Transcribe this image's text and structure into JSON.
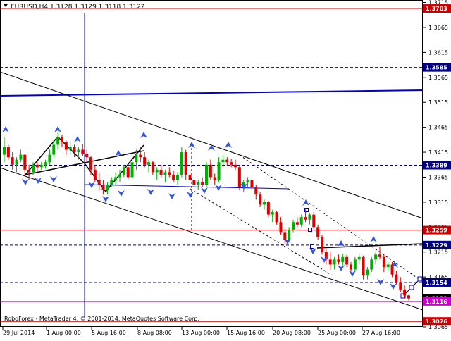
{
  "window": {
    "symbol_header": "EURUSD,H4  1.3128 1.3129 1.3118 1.3122",
    "copyright": "RoboForex - MetaTrader 4, © 2001-2014, MetaQuotes Software Corp."
  },
  "chart_data": {
    "type": "candlestick",
    "symbol": "EURUSD",
    "timeframe": "H4",
    "ohlc_last": {
      "open": 1.3128,
      "high": 1.3129,
      "low": 1.3118,
      "close": 1.3122
    },
    "ylim": [
      1.3065,
      1.372
    ],
    "y_ticks": [
      "1.3715",
      "1.3665",
      "1.3615",
      "1.3565",
      "1.3515",
      "1.3465",
      "1.3415",
      "1.3365",
      "1.3315",
      "1.3265",
      "1.3215",
      "1.3165",
      "1.3115",
      "1.3065"
    ],
    "x_tick_labels": [
      "29 Jul 2014",
      "1 Aug 00:00",
      "5 Aug 16:00",
      "8 Aug 08:00",
      "13 Aug 00:00",
      "15 Aug 16:00",
      "20 Aug 08:00",
      "25 Aug 00:00",
      "27 Aug 16:00"
    ],
    "price_levels": [
      {
        "label": "1.3703",
        "value": 1.3703,
        "style": "solid",
        "color": "#cc0000"
      },
      {
        "label": "1.3585",
        "value": 1.3585,
        "style": "dashed",
        "color": "#000080"
      },
      {
        "label": "1.3389",
        "value": 1.3389,
        "style": "dashed",
        "color": "#000080"
      },
      {
        "label": "1.3259",
        "value": 1.3259,
        "style": "solid",
        "color": "#cc0000"
      },
      {
        "label": "1.3229",
        "value": 1.3229,
        "style": "dashed",
        "color": "#000080"
      },
      {
        "label": "1.3154",
        "value": 1.3154,
        "style": "dashed",
        "color": "#000080"
      },
      {
        "label": "1.3122",
        "value": 1.3122,
        "style": "solid",
        "color": "#000000"
      },
      {
        "label": "1.3116",
        "value": 1.3116,
        "style": "solid",
        "color": "#cc00cc"
      },
      {
        "label": "1.3076",
        "value": 1.3076,
        "style": "solid",
        "color": "#cc0000"
      }
    ],
    "candles": [
      [
        1.341,
        1.3445,
        1.3395,
        1.3425
      ],
      [
        1.3425,
        1.343,
        1.34,
        1.3405
      ],
      [
        1.3405,
        1.3415,
        1.338,
        1.339
      ],
      [
        1.339,
        1.3405,
        1.3375,
        1.34
      ],
      [
        1.34,
        1.342,
        1.3395,
        1.341
      ],
      [
        1.341,
        1.3412,
        1.337,
        1.338
      ],
      [
        1.338,
        1.339,
        1.336,
        1.3375
      ],
      [
        1.3375,
        1.3395,
        1.337,
        1.339
      ],
      [
        1.339,
        1.3398,
        1.3375,
        1.3385
      ],
      [
        1.3385,
        1.3395,
        1.338,
        1.339
      ],
      [
        1.339,
        1.34,
        1.3382,
        1.3395
      ],
      [
        1.3395,
        1.342,
        1.339,
        1.341
      ],
      [
        1.341,
        1.344,
        1.3405,
        1.343
      ],
      [
        1.343,
        1.3455,
        1.342,
        1.3445
      ],
      [
        1.3445,
        1.345,
        1.3425,
        1.3435
      ],
      [
        1.3435,
        1.344,
        1.341,
        1.342
      ],
      [
        1.342,
        1.3435,
        1.3412,
        1.3425
      ],
      [
        1.3425,
        1.343,
        1.3405,
        1.3415
      ],
      [
        1.3415,
        1.3425,
        1.34,
        1.342
      ],
      [
        1.342,
        1.3432,
        1.3408,
        1.3412
      ],
      [
        1.3412,
        1.342,
        1.3395,
        1.3405
      ],
      [
        1.3405,
        1.3408,
        1.337,
        1.338
      ],
      [
        1.338,
        1.339,
        1.3355,
        1.336
      ],
      [
        1.336,
        1.3375,
        1.334,
        1.335
      ],
      [
        1.335,
        1.336,
        1.333,
        1.334
      ],
      [
        1.334,
        1.3355,
        1.333,
        1.335
      ],
      [
        1.335,
        1.3365,
        1.3345,
        1.336
      ],
      [
        1.336,
        1.3375,
        1.335,
        1.3365
      ],
      [
        1.3365,
        1.338,
        1.3355,
        1.337
      ],
      [
        1.337,
        1.339,
        1.3365,
        1.3385
      ],
      [
        1.3385,
        1.3395,
        1.336,
        1.3365
      ],
      [
        1.3365,
        1.34,
        1.336,
        1.3395
      ],
      [
        1.3395,
        1.342,
        1.338,
        1.341
      ],
      [
        1.341,
        1.3425,
        1.3395,
        1.3405
      ],
      [
        1.3405,
        1.3415,
        1.3385,
        1.339
      ],
      [
        1.339,
        1.34,
        1.3375,
        1.3395
      ],
      [
        1.3395,
        1.3398,
        1.337,
        1.3375
      ],
      [
        1.3375,
        1.3385,
        1.336,
        1.338
      ],
      [
        1.338,
        1.339,
        1.3365,
        1.337
      ],
      [
        1.337,
        1.338,
        1.3355,
        1.3375
      ],
      [
        1.3375,
        1.3385,
        1.3365,
        1.337
      ],
      [
        1.337,
        1.3378,
        1.3355,
        1.336
      ],
      [
        1.336,
        1.3375,
        1.335,
        1.337
      ],
      [
        1.337,
        1.3425,
        1.3365,
        1.3415
      ],
      [
        1.3415,
        1.342,
        1.336,
        1.337
      ],
      [
        1.337,
        1.338,
        1.3355,
        1.336
      ],
      [
        1.336,
        1.3368,
        1.3345,
        1.335
      ],
      [
        1.335,
        1.336,
        1.334,
        1.3355
      ],
      [
        1.3355,
        1.3365,
        1.3345,
        1.335
      ],
      [
        1.335,
        1.3395,
        1.3345,
        1.339
      ],
      [
        1.339,
        1.34,
        1.336,
        1.3365
      ],
      [
        1.3365,
        1.3372,
        1.335,
        1.336
      ],
      [
        1.336,
        1.3405,
        1.3355,
        1.3395
      ],
      [
        1.3395,
        1.341,
        1.3385,
        1.34
      ],
      [
        1.34,
        1.3405,
        1.3388,
        1.3395
      ],
      [
        1.3395,
        1.3402,
        1.3385,
        1.339
      ],
      [
        1.339,
        1.34,
        1.338,
        1.3385
      ],
      [
        1.3385,
        1.339,
        1.334,
        1.3345
      ],
      [
        1.3345,
        1.336,
        1.3335,
        1.3355
      ],
      [
        1.3355,
        1.3365,
        1.3345,
        1.336
      ],
      [
        1.336,
        1.3363,
        1.334,
        1.3345
      ],
      [
        1.3345,
        1.335,
        1.332,
        1.333
      ],
      [
        1.333,
        1.3335,
        1.3305,
        1.331
      ],
      [
        1.331,
        1.332,
        1.33,
        1.3315
      ],
      [
        1.3315,
        1.3318,
        1.3285,
        1.329
      ],
      [
        1.329,
        1.33,
        1.3275,
        1.3295
      ],
      [
        1.3295,
        1.3298,
        1.327,
        1.3275
      ],
      [
        1.3275,
        1.3285,
        1.325,
        1.3255
      ],
      [
        1.3255,
        1.3262,
        1.3232,
        1.324
      ],
      [
        1.324,
        1.3265,
        1.3235,
        1.326
      ],
      [
        1.326,
        1.328,
        1.3255,
        1.3275
      ],
      [
        1.3275,
        1.3285,
        1.3265,
        1.327
      ],
      [
        1.327,
        1.329,
        1.3265,
        1.3285
      ],
      [
        1.3285,
        1.33,
        1.3275,
        1.328
      ],
      [
        1.328,
        1.3292,
        1.327,
        1.329
      ],
      [
        1.329,
        1.3298,
        1.326,
        1.3265
      ],
      [
        1.3265,
        1.327,
        1.324,
        1.3245
      ],
      [
        1.3245,
        1.325,
        1.321,
        1.3215
      ],
      [
        1.3215,
        1.322,
        1.319,
        1.32
      ],
      [
        1.32,
        1.3215,
        1.318,
        1.319
      ],
      [
        1.319,
        1.3205,
        1.318,
        1.32
      ],
      [
        1.32,
        1.321,
        1.319,
        1.3195
      ],
      [
        1.3195,
        1.3212,
        1.3188,
        1.3205
      ],
      [
        1.3205,
        1.321,
        1.3185,
        1.319
      ],
      [
        1.319,
        1.3195,
        1.3175,
        1.318
      ],
      [
        1.318,
        1.3205,
        1.3175,
        1.32
      ],
      [
        1.32,
        1.3212,
        1.319,
        1.3205
      ],
      [
        1.3205,
        1.3208,
        1.316,
        1.3168
      ],
      [
        1.3168,
        1.3185,
        1.316,
        1.318
      ],
      [
        1.318,
        1.3205,
        1.3175,
        1.32
      ],
      [
        1.32,
        1.3215,
        1.319,
        1.321
      ],
      [
        1.321,
        1.3225,
        1.32,
        1.3205
      ],
      [
        1.3205,
        1.3212,
        1.3175,
        1.3185
      ],
      [
        1.3185,
        1.3195,
        1.3178,
        1.319
      ],
      [
        1.319,
        1.3195,
        1.3165,
        1.317
      ],
      [
        1.317,
        1.3178,
        1.315,
        1.3155
      ],
      [
        1.3155,
        1.3165,
        1.3135,
        1.314
      ],
      [
        1.314,
        1.3148,
        1.3122,
        1.3128
      ],
      [
        1.3128,
        1.3129,
        1.3118,
        1.3122
      ]
    ],
    "annotations": "trend channel lines, fractal arrows, wave lines, forecast path"
  }
}
